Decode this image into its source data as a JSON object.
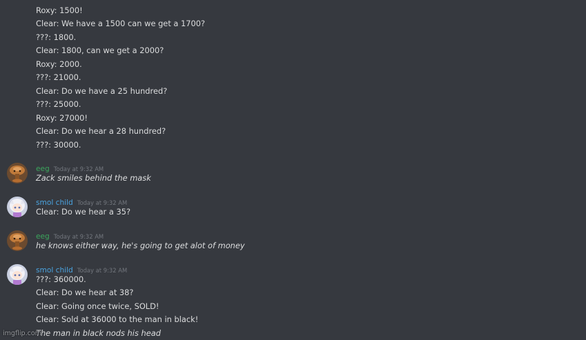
{
  "colors": {
    "background": "#36393f",
    "eeg_name": "#3ba55c",
    "smol_name": "#4aa3df",
    "text": "#dcddde",
    "timestamp": "#72767d"
  },
  "top_messages": [
    "Roxy: 1500!",
    "Clear: We have a 1500 can we get a 1700?",
    "???: 1800.",
    "Clear: 1800, can we get a 2000?",
    "Roxy: 2000.",
    "???: 21000.",
    "Clear: Do we have a 25 hundred?",
    "???: 25000.",
    "Roxy: 27000!",
    "Clear: Do we hear a 28 hundred?",
    "???: 30000."
  ],
  "groups": [
    {
      "author": "eeg",
      "timestamp": "Today at 9:32 AM",
      "avatar_icon": "brown-cartoon-avatar-icon",
      "messages": [
        {
          "text": "Zack smiles behind the mask",
          "italic": true
        }
      ]
    },
    {
      "author": "smol child",
      "timestamp": "Today at 9:32 AM",
      "avatar_icon": "white-haired-girl-avatar-icon",
      "messages": [
        {
          "text": "Clear: Do we hear a 35?",
          "italic": false
        }
      ]
    },
    {
      "author": "eeg",
      "timestamp": "Today at 9:32 AM",
      "avatar_icon": "brown-cartoon-avatar-icon",
      "messages": [
        {
          "text": "he knows either way, he's going to get alot of money",
          "italic": true
        }
      ]
    },
    {
      "author": "smol child",
      "timestamp": "Today at 9:32 AM",
      "avatar_icon": "white-haired-girl-avatar-icon",
      "messages": [
        {
          "text": "???: 360000.",
          "italic": false
        },
        {
          "text": "Clear: Do we hear at 38?",
          "italic": false
        },
        {
          "text": "Clear: Going once twice, SOLD!",
          "italic": false
        },
        {
          "text": "Clear: Sold at 36000 to the man in black!",
          "italic": false
        },
        {
          "text": "The man in black nods his head",
          "italic": true
        }
      ]
    }
  ],
  "watermark": "imgflip.com"
}
